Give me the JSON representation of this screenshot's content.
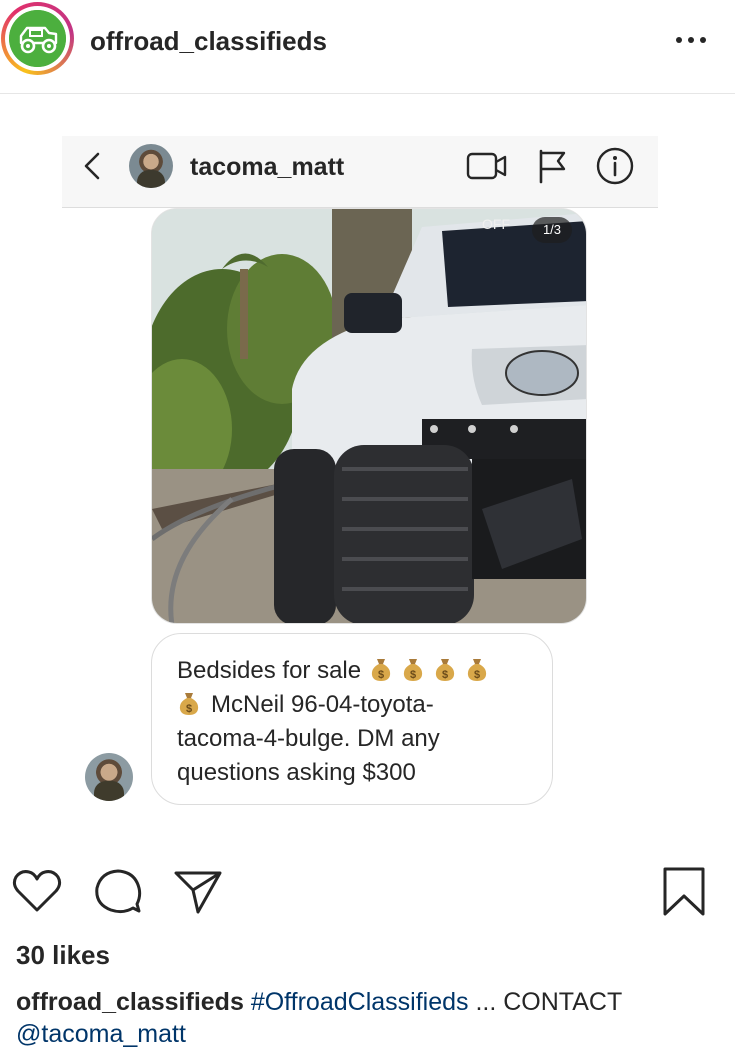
{
  "post": {
    "account_name": "offroad_classifieds",
    "more_icon": "more-horizontal-icon",
    "likes": "30 likes",
    "caption": {
      "user": "offroad_classifieds",
      "hashtag": "#OffroadClassifieds",
      "text": " ... CONTACT ",
      "mention": "@tacoma_matt"
    }
  },
  "dm": {
    "username": "tacoma_matt",
    "icons": {
      "back": "chevron-left-icon",
      "video": "video-camera-icon",
      "flag": "flag-icon",
      "info": "info-icon"
    },
    "photo_counter": "1/3",
    "message": {
      "line1": "Bedsides for sale",
      "line2": "McNeil 96-04-toyota-",
      "line3": "tacoma-4-bulge. DM any",
      "line4": "questions asking $300",
      "emoji": "money-bag-icon"
    }
  },
  "actions": {
    "like": "heart-icon",
    "comment": "comment-icon",
    "share": "paper-plane-icon",
    "save": "bookmark-icon"
  },
  "colors": {
    "text": "#262626",
    "hashtag": "#003569",
    "border": "#dbdbdb",
    "logo_green": "#4caf3e"
  }
}
